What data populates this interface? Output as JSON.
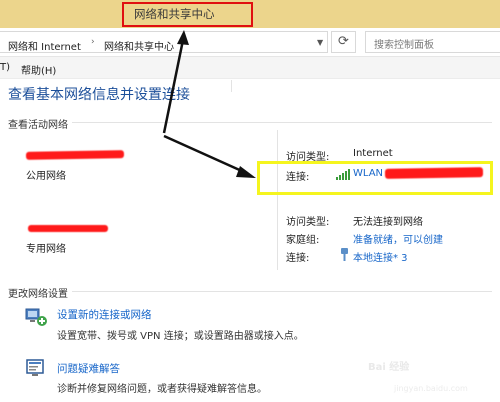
{
  "window": {
    "title": "网络和共享中心"
  },
  "address": {
    "breadcrumbs": [
      "网络和 Internet",
      "网络和共享中心"
    ],
    "separator": "›",
    "search_placeholder": "搜索控制面板"
  },
  "menu": {
    "items": [
      "T)",
      "帮助(H)"
    ]
  },
  "page": {
    "title": "查看基本网络信息并设置连接"
  },
  "active_networks": {
    "heading": "查看活动网络",
    "networks": [
      {
        "category": "公用网络",
        "props": [
          {
            "label": "访问类型:",
            "value": "Internet"
          },
          {
            "label": "连接:",
            "value": "WLAN"
          }
        ]
      },
      {
        "category": "专用网络",
        "props": [
          {
            "label": "访问类型:",
            "value": "无法连接到网络"
          },
          {
            "label": "家庭组:",
            "value": "准备就绪，可以创建"
          },
          {
            "label": "连接:",
            "value": "本地连接* 3"
          }
        ]
      }
    ]
  },
  "change_settings": {
    "heading": "更改网络设置",
    "tasks": [
      {
        "link": "设置新的连接或网络",
        "desc": "设置宽带、拨号或 VPN 连接；或设置路由器或接入点。"
      },
      {
        "link": "问题疑难解答",
        "desc": "诊断并修复网络问题，或者获得疑难解答信息。"
      }
    ]
  },
  "watermark": {
    "text": "Bai 经验",
    "sub": "jingyan.baidu.com"
  },
  "colors": {
    "title_bar": "#ecd58c",
    "link": "#1766c9",
    "title": "#1c4f9a",
    "annotation_red": "#e01010",
    "annotation_yellow": "#f5f51e"
  }
}
